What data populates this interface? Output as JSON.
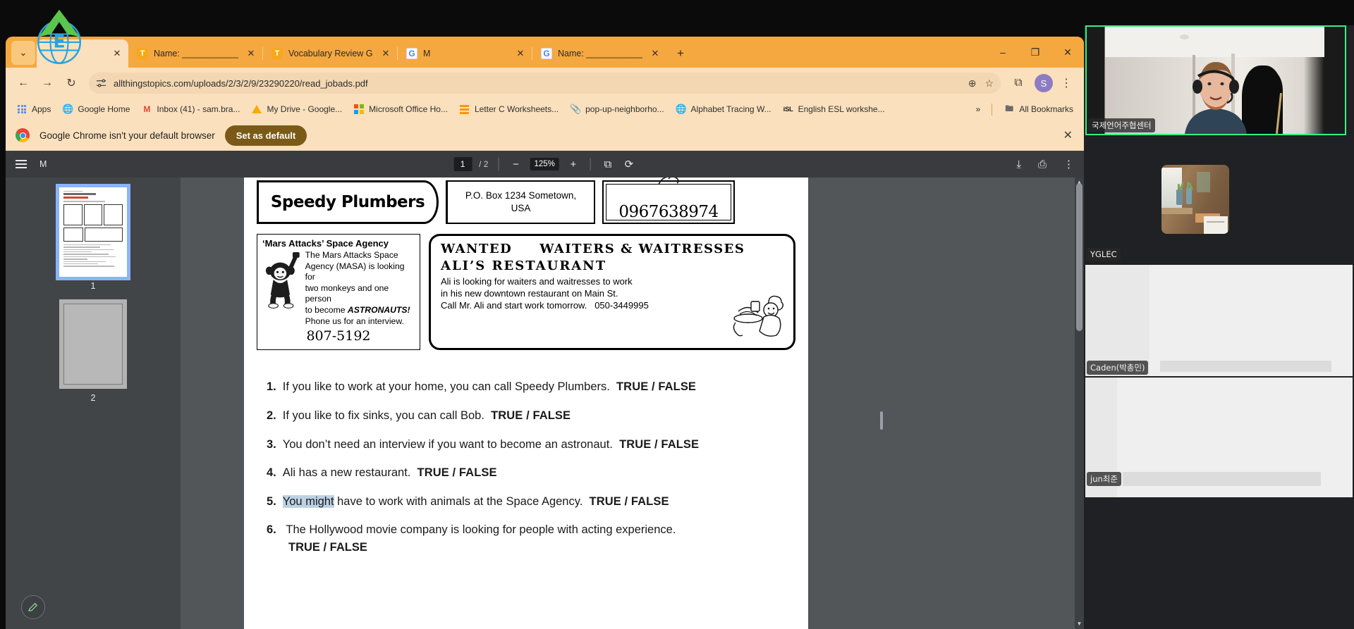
{
  "window": {
    "minimize_label": "–",
    "maximize_label": "❐",
    "close_label": "✕",
    "tabstrip_chevron": "⌄",
    "newtab_label": "+"
  },
  "tabs": [
    {
      "title": "",
      "favicon": "twinkl-icon",
      "active": true,
      "close_label": "✕"
    },
    {
      "title": "Name: _______________ I",
      "favicon": "twinkl-icon",
      "active": false,
      "close_label": "✕"
    },
    {
      "title": "Vocabulary Review Grid",
      "favicon": "twinkl-icon",
      "active": false,
      "close_label": "✕"
    },
    {
      "title": "M",
      "favicon": "google-icon",
      "active": false,
      "close_label": "✕"
    },
    {
      "title": "Name: _______________ I",
      "favicon": "google-icon",
      "active": false,
      "close_label": "✕"
    }
  ],
  "toolbar": {
    "back_label": "←",
    "forward_label": "→",
    "reload_label": "↻",
    "url": "allthingstopics.com/uploads/2/3/2/9/23290220/read_jobads.pdf",
    "site_info_icon": "tune-icon",
    "zoom_icon": "⊕",
    "bookmark_star": "☆",
    "extensions_icon": "⧉",
    "profile_initial": "S",
    "menu_icon": "⋮"
  },
  "bookmarks": [
    {
      "label": "Apps",
      "icon": "apps-grid-icon"
    },
    {
      "label": "Google Home",
      "icon": "globe-icon"
    },
    {
      "label": "Inbox (41) - sam.bra...",
      "icon": "gmail-icon"
    },
    {
      "label": "My Drive - Google...",
      "icon": "drive-icon"
    },
    {
      "label": "Microsoft Office Ho...",
      "icon": "microsoft-icon"
    },
    {
      "label": "Letter C Worksheets...",
      "icon": "orange-lines-icon"
    },
    {
      "label": "pop-up-neighborho...",
      "icon": "clip-icon"
    },
    {
      "label": "Alphabet Tracing W...",
      "icon": "globe-icon"
    },
    {
      "label": "English ESL workshe...",
      "icon": "isl-icon"
    }
  ],
  "bookmarks_overflow": "»",
  "all_bookmarks": {
    "label": "All Bookmarks",
    "icon": "folder-icon"
  },
  "default_banner": {
    "message": "Google Chrome isn't your default browser",
    "button_label": "Set as default",
    "close_label": "✕"
  },
  "pdf_viewer": {
    "document_title": "M",
    "menu_icon": "hamburger-icon",
    "current_page": "1",
    "total_pages": "/ 2",
    "zoom_out_label": "−",
    "zoom_level": "125%",
    "zoom_in_label": "+",
    "fit_label": "⧉",
    "rotate_label": "⟳",
    "download_label": "⤓",
    "print_label": "⎙",
    "more_label": "⋮",
    "thumbnails": [
      {
        "page_label": "1",
        "selected": true
      },
      {
        "page_label": "2",
        "selected": false
      }
    ],
    "edit_fab_icon": "pencil-icon",
    "scroll_up": "▲",
    "scroll_down": "▼"
  },
  "worksheet": {
    "ads": {
      "speedy": {
        "title": "Speedy Plumbers"
      },
      "pobox": {
        "line1": "P.O. Box 1234 Sometown,",
        "line2": "USA"
      },
      "phone_box": {
        "number": "0967638974"
      },
      "masa": {
        "title_quoted": "‘Mars Attacks’",
        "title_rest": "Space Agency",
        "body_line1": "The Mars Attacks Space",
        "body_line2": "Agency (MASA) is looking for",
        "body_line3": "two monkeys and one person",
        "body_line4_prefix": "to become ",
        "body_line4_em": "ASTRONAUTS!",
        "body_line5": "Phone us for an interview.",
        "phone": "807-5192"
      },
      "ali": {
        "heading1": "WANTED  WAITERS & WAITRESSES",
        "heading2": "ALI’S RESTAURANT",
        "body_line1": "Ali is looking for waiters and waitresses to work",
        "body_line2": "in his new downtown restaurant on Main St.",
        "body_line3": "Call Mr. Ali and start work tomorrow.",
        "body_phone": "050-3449995"
      }
    },
    "questions": [
      {
        "num": "1.",
        "pre": "If you like to work at your home, you can call Speedy Plumbers.",
        "answer": "TRUE / FALSE",
        "highlight": ""
      },
      {
        "num": "2.",
        "pre": "If you like to fix sinks, you can call Bob.",
        "answer": "TRUE / FALSE",
        "highlight": ""
      },
      {
        "num": "3.",
        "pre": "You don’t need an interview if you want to become an astronaut.",
        "answer": "TRUE / FALSE",
        "highlight": ""
      },
      {
        "num": "4.",
        "pre": "Ali has a new restaurant.",
        "answer": "TRUE / FALSE",
        "highlight": ""
      },
      {
        "num": "5.",
        "pre": " have to work with animals at the Space Agency.",
        "answer": "TRUE / FALSE",
        "highlight": "You might"
      },
      {
        "num": "6.",
        "pre": "The Hollywood movie company is looking for people with acting experience.",
        "answer": "TRUE / FALSE",
        "highlight": ""
      }
    ]
  },
  "video_panel": {
    "speaker": {
      "name": "국제언어주협센터",
      "active_border_color": "#37f07e"
    },
    "participants": [
      {
        "name": "YGLEC"
      },
      {
        "name": "Caden(박총민)"
      },
      {
        "name": "jun최준"
      }
    ]
  }
}
